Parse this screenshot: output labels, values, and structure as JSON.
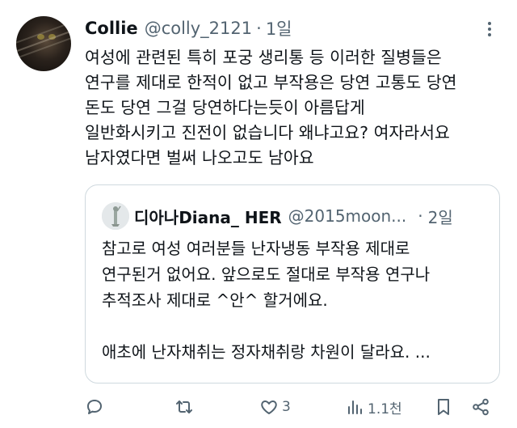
{
  "tweet": {
    "display_name": "Collie",
    "handle": "@colly_2121",
    "separator": "·",
    "time": "1일",
    "body_lines": [
      "여성에 관련된 특히 포궁 생리통 등 이러한 질병들은",
      "연구를 제대로 한적이 없고 부작용은 당연 고통도 당연",
      "돈도 당연 그걸 당연하다는듯이 아름답게",
      "일반화시키고 진전이 없습니다 왜냐고요? 여자라서요",
      "남자였다면 벌써 나오고도 남아요"
    ]
  },
  "quote": {
    "display_name": "디아나Diana_ HER",
    "handle": "@2015moon...",
    "separator": "·",
    "time": "2일",
    "body_lines": [
      "참고로 여성 여러분들 난자냉동 부작용 제대로",
      "연구된거 없어요. 앞으로도 절대로 부작용 연구나",
      "추적조사 제대로 ^안^ 할거에요.",
      "",
      "애초에 난자채취는 정자채취랑 차원이 달라요. ..."
    ]
  },
  "actions": {
    "reply_icon": "reply-icon",
    "retweet_icon": "retweet-icon",
    "like_icon": "heart-icon",
    "like_count": "3",
    "views_icon": "views-icon",
    "views_count": "1.1천",
    "bookmark_icon": "bookmark-icon",
    "share_icon": "share-icon"
  },
  "colors": {
    "text": "#0f1419",
    "secondary": "#536471",
    "border": "#cfd9de",
    "background": "#ffffff"
  }
}
